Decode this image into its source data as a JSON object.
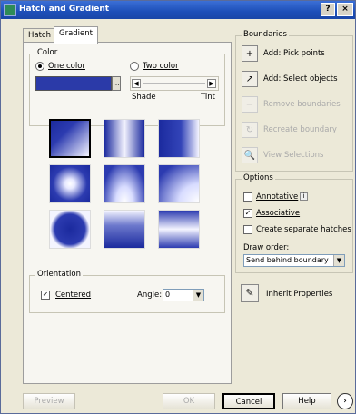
{
  "window": {
    "title": "Hatch and Gradient",
    "help_btn": "?",
    "close_btn": "×"
  },
  "tabs": [
    {
      "label": "Hatch"
    },
    {
      "label": "Gradient"
    }
  ],
  "color": {
    "group_label": "Color",
    "one_color_label": "One color",
    "two_color_label": "Two color",
    "shade_label": "Shade",
    "tint_label": "Tint",
    "swatch_color": "#2b3aa8"
  },
  "orientation": {
    "group_label": "Orientation",
    "centered_label": "Centered",
    "centered_mark": "✓",
    "angle_label": "Angle:",
    "angle_value": "0"
  },
  "boundaries": {
    "group_label": "Boundaries",
    "items": [
      {
        "label": "Add: Pick points",
        "icon": "+"
      },
      {
        "label": "Add: Select objects",
        "icon": "↗"
      },
      {
        "label": "Remove boundaries",
        "icon": "−"
      },
      {
        "label": "Recreate boundary",
        "icon": "↻"
      },
      {
        "label": "View Selections",
        "icon": "🔍"
      }
    ]
  },
  "options": {
    "group_label": "Options",
    "annotative_label": "Annotative",
    "info_glyph": "i",
    "associative_label": "Associative",
    "associative_mark": "✓",
    "separate_label": "Create separate hatches",
    "draw_order_label": "Draw order:",
    "draw_order_value": "Send behind boundary"
  },
  "inherit_label": "Inherit Properties",
  "footer": {
    "preview": "Preview",
    "ok": "OK",
    "cancel": "Cancel",
    "help": "Help",
    "more": "›"
  }
}
